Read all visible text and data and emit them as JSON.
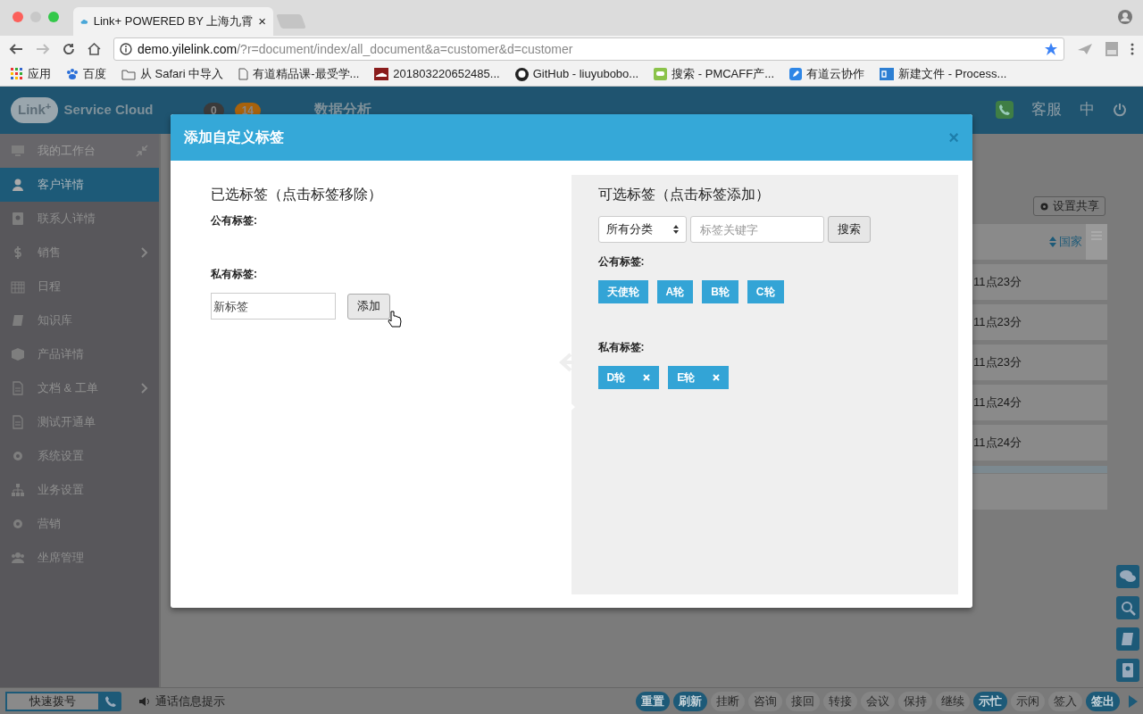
{
  "browser": {
    "tab_title": "Link+ POWERED BY 上海九霄",
    "tab_close": "×",
    "url_host": "demo.yilelink.com",
    "url_path": "/?r=document/index/all_document&a=customer&d=customer",
    "bookmarks": [
      {
        "label": "应用"
      },
      {
        "label": "百度"
      },
      {
        "label": "从 Safari 中导入"
      },
      {
        "label": "有道精品课-最受学..."
      },
      {
        "label": "201803220652485..."
      },
      {
        "label": "GitHub - liuyubobo..."
      },
      {
        "label": "搜索 - PMCAFF产..."
      },
      {
        "label": "有道云协作"
      },
      {
        "label": "新建文件 - Process..."
      }
    ]
  },
  "header": {
    "logo_mark": "Link",
    "logo_sup": "+",
    "logo_text": "Service Cloud",
    "badges": [
      {
        "count": "0",
        "color": "#3a3a3a"
      },
      {
        "count": "14",
        "color": "#a8620c"
      }
    ],
    "nav": "数据分析",
    "service": "客服",
    "language": "中"
  },
  "sidebar": {
    "items": [
      {
        "label": "我的工作台",
        "selected": false,
        "submenu": false
      },
      {
        "label": "客户详情",
        "selected": true,
        "submenu": false
      },
      {
        "label": "联系人详情",
        "selected": false,
        "submenu": false
      },
      {
        "label": "销售",
        "selected": false,
        "submenu": true
      },
      {
        "label": "日程",
        "selected": false,
        "submenu": false
      },
      {
        "label": "知识库",
        "selected": false,
        "submenu": false
      },
      {
        "label": "产品详情",
        "selected": false,
        "submenu": false
      },
      {
        "label": "文档 & 工单",
        "selected": false,
        "submenu": true
      },
      {
        "label": "测试开通单",
        "selected": false,
        "submenu": false
      },
      {
        "label": "系统设置",
        "selected": false,
        "submenu": false
      },
      {
        "label": "业务设置",
        "selected": false,
        "submenu": false
      },
      {
        "label": "营销",
        "selected": false,
        "submenu": false
      },
      {
        "label": "坐席管理",
        "selected": false,
        "submenu": false
      }
    ]
  },
  "background": {
    "share_button": "设置共享",
    "column": "国家",
    "rows": [
      "11点23分",
      "11点23分",
      "11点23分",
      "11点24分",
      "11点24分"
    ]
  },
  "dialog": {
    "title": "添加自定义标签",
    "close": "×",
    "selected_panel": {
      "heading": "已选标签（点击标签移除）",
      "public_label": "公有标签:",
      "private_label": "私有标签:",
      "new_tag": {
        "placeholder": "新标签"
      },
      "add_button": "添加"
    },
    "available_panel": {
      "heading": "可选标签（点击标签添加）",
      "category": "所有分类",
      "keyword": {
        "placeholder": "标签关键字"
      },
      "search_button": "搜索",
      "public_label": "公有标签:",
      "public_tags": [
        {
          "label": "天使轮",
          "removable": false
        },
        {
          "label": "A轮",
          "removable": false
        },
        {
          "label": "B轮",
          "removable": false
        },
        {
          "label": "C轮",
          "removable": false
        }
      ],
      "private_label": "私有标签:",
      "private_tags": [
        {
          "label": "D轮",
          "removable": true
        },
        {
          "label": "E轮",
          "removable": true
        }
      ]
    }
  },
  "call_bar": {
    "quick_dial": "快速拨号",
    "notice": "通话信息提示",
    "buttons": [
      {
        "label": "重置",
        "enabled": true
      },
      {
        "label": "刷新",
        "enabled": true
      },
      {
        "label": "挂断",
        "enabled": false
      },
      {
        "label": "咨询",
        "enabled": false
      },
      {
        "label": "接回",
        "enabled": false
      },
      {
        "label": "转接",
        "enabled": false
      },
      {
        "label": "会议",
        "enabled": false
      },
      {
        "label": "保持",
        "enabled": false
      },
      {
        "label": "继续",
        "enabled": false
      },
      {
        "label": "示忙",
        "enabled": true
      },
      {
        "label": "示闲",
        "enabled": false
      },
      {
        "label": "签入",
        "enabled": false
      },
      {
        "label": "签出",
        "enabled": true
      }
    ]
  }
}
